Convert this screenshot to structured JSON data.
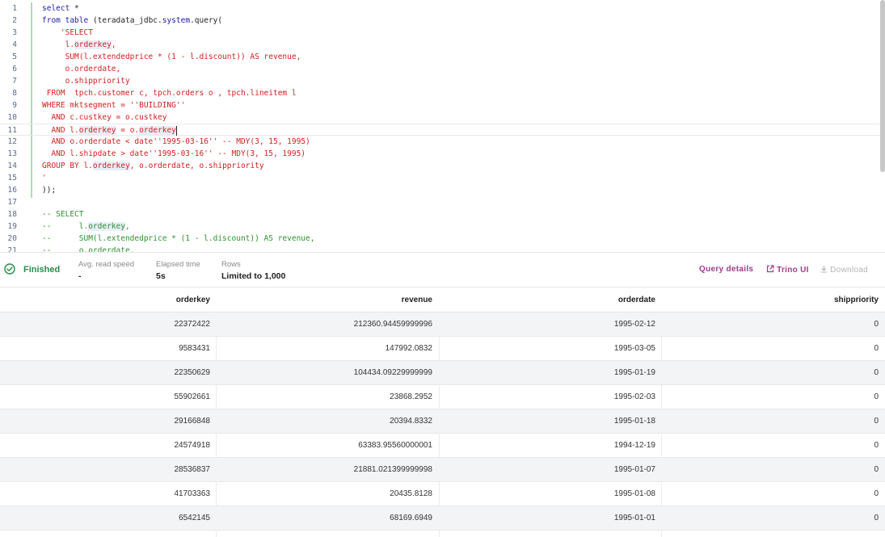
{
  "editor": {
    "lines": [
      {
        "num": "1",
        "segments": [
          {
            "t": "select ",
            "c": "k"
          },
          {
            "t": "*",
            "c": "p"
          }
        ]
      },
      {
        "num": "2",
        "segments": [
          {
            "t": "from ",
            "c": "k"
          },
          {
            "t": "table ",
            "c": "k"
          },
          {
            "t": "(teradata_jdbc.",
            "c": "p"
          },
          {
            "t": "system",
            "c": "k"
          },
          {
            "t": ".query(",
            "c": "p"
          }
        ]
      },
      {
        "num": "3",
        "segments": [
          {
            "t": "    'SELECT",
            "c": "s"
          }
        ]
      },
      {
        "num": "4",
        "segments": [
          {
            "t": "     l.",
            "c": "s"
          },
          {
            "t": "orderkey",
            "c": "s",
            "hl": true
          },
          {
            "t": ",",
            "c": "s"
          }
        ]
      },
      {
        "num": "5",
        "segments": [
          {
            "t": "     SUM(l.extendedprice * (1 - l.discount)) AS revenue,",
            "c": "s"
          }
        ]
      },
      {
        "num": "6",
        "segments": [
          {
            "t": "     o.orderdate,",
            "c": "s"
          }
        ]
      },
      {
        "num": "7",
        "segments": [
          {
            "t": "     o.shippriority",
            "c": "s"
          }
        ]
      },
      {
        "num": "8",
        "segments": [
          {
            "t": " FROM  tpch.customer c, tpch.orders o , tpch.lineitem l",
            "c": "s"
          }
        ]
      },
      {
        "num": "9",
        "segments": [
          {
            "t": "WHERE mktsegment = ''BUILDING''",
            "c": "s"
          }
        ]
      },
      {
        "num": "10",
        "segments": [
          {
            "t": "  AND c.custkey = o.custkey",
            "c": "s"
          }
        ]
      },
      {
        "num": "11",
        "active": true,
        "cursor": true,
        "segments": [
          {
            "t": "  AND l.",
            "c": "s"
          },
          {
            "t": "orderkey",
            "c": "s",
            "hl": true
          },
          {
            "t": " = o.",
            "c": "s"
          },
          {
            "t": "orderkey",
            "c": "s",
            "hl": true
          }
        ]
      },
      {
        "num": "12",
        "segments": [
          {
            "t": "  AND o.orderdate < date''1995-03-16'' -- MDY(3, 15, 1995)",
            "c": "s"
          }
        ]
      },
      {
        "num": "13",
        "segments": [
          {
            "t": "  AND l.shipdate > date''1995-03-16'' -- MDY(3, 15, 1995)",
            "c": "s"
          }
        ]
      },
      {
        "num": "14",
        "segments": [
          {
            "t": "GROUP BY l.",
            "c": "s"
          },
          {
            "t": "orderkey",
            "c": "s",
            "hl": true
          },
          {
            "t": ", o.orderdate, o.shippriority",
            "c": "s"
          }
        ]
      },
      {
        "num": "15",
        "segments": [
          {
            "t": "'",
            "c": "s"
          }
        ]
      },
      {
        "num": "16",
        "segments": [
          {
            "t": "));",
            "c": "p"
          }
        ]
      },
      {
        "num": "17",
        "segments": []
      },
      {
        "num": "18",
        "segments": [
          {
            "t": "-- SELECT",
            "c": "c"
          }
        ]
      },
      {
        "num": "19",
        "segments": [
          {
            "t": "--      l.",
            "c": "c"
          },
          {
            "t": "orderkey",
            "c": "c",
            "hl": true
          },
          {
            "t": ",",
            "c": "c"
          }
        ]
      },
      {
        "num": "20",
        "segments": [
          {
            "t": "--      SUM(l.extendedprice * (1 - l.discount)) AS revenue,",
            "c": "c"
          }
        ]
      },
      {
        "num": "21",
        "segments": [
          {
            "t": "--      o.orderdate,",
            "c": "c"
          }
        ]
      }
    ]
  },
  "status": {
    "state": "Finished",
    "avg_read_speed_label": "Avg. read speed",
    "avg_read_speed_value": "-",
    "elapsed_label": "Elapsed time",
    "elapsed_value": "5s",
    "rows_label": "Rows",
    "rows_value": "Limited to 1,000",
    "query_details": "Query details",
    "trino_ui": "Trino UI",
    "download": "Download",
    "colors": {
      "finished": "#2a8a4a",
      "link": "#a03a8c",
      "disabled": "#b5b5b5"
    },
    "icons": {
      "status": "check-circle-icon",
      "trino": "external-link-icon",
      "download": "download-icon"
    }
  },
  "table": {
    "columns": [
      "orderkey",
      "revenue",
      "orderdate",
      "shippriority"
    ],
    "rows": [
      [
        "22372422",
        "212360.94459999996",
        "1995-02-12",
        "0"
      ],
      [
        "9583431",
        "147992.0832",
        "1995-03-05",
        "0"
      ],
      [
        "22350629",
        "104434.09229999999",
        "1995-01-19",
        "0"
      ],
      [
        "55902661",
        "23868.2952",
        "1995-02-03",
        "0"
      ],
      [
        "29166848",
        "20394.8332",
        "1995-01-18",
        "0"
      ],
      [
        "24574918",
        "63383.95560000001",
        "1994-12-19",
        "0"
      ],
      [
        "28536837",
        "21881.021399999998",
        "1995-01-07",
        "0"
      ],
      [
        "41703363",
        "20435.8128",
        "1995-01-08",
        "0"
      ],
      [
        "6542145",
        "68169.6949",
        "1995-01-01",
        "0"
      ]
    ]
  }
}
